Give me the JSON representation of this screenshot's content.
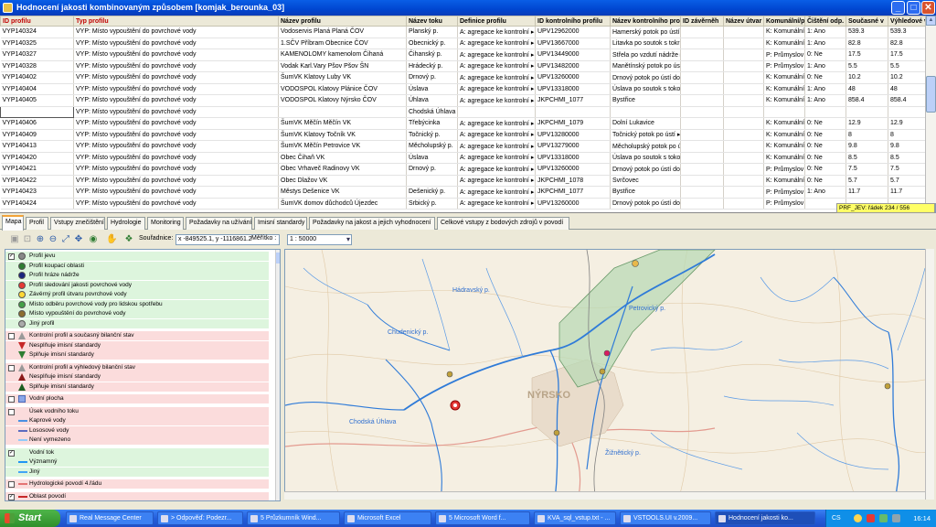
{
  "window": {
    "title": "Hodnocení  jakosti kombinovaným způsobem [komjak_berounka_03]"
  },
  "grid": {
    "columns": [
      "ID profilu",
      "Typ profilu",
      "Název profilu",
      "Název toku",
      "Definice profilu",
      "ID kontrolního profilu",
      "Název kontrolního profi",
      "ID závěrněh",
      "Název útvar",
      "Komunální/p",
      "Čištění odp.",
      "Současné v",
      "Výhledové v"
    ],
    "rows": [
      [
        "VYP140324",
        "VYP: Místo vypouštění do povrchové vody",
        "Vodoservis Planá Planá ČOV",
        "Planský p.",
        "A: agregace ke kontrolní ▸",
        "UPV12962000",
        "Hamerský potok po ústí ▸",
        "",
        "",
        "K: Komunální",
        "1: Ano",
        "539.3",
        "539.3"
      ],
      [
        "VYP140325",
        "VYP: Místo vypouštění do povrchové vody",
        "1.SČV Příbram Obecnice ČOV",
        "Obecnický p.",
        "A: agregace ke kontrolní ▸",
        "UPV13667000",
        "Litavka po soutok s tokr ▸",
        "",
        "",
        "K: Komunální",
        "1: Ano",
        "82.8",
        "82.8"
      ],
      [
        "VYP140327",
        "VYP: Místo vypouštění do povrchové vody",
        "KAMENOLOMY kamenolom Čihaná",
        "Čihanský p.",
        "A: agregace ke kontrolní ▸",
        "UPV13449000",
        "Střela po vzdutí nádrže ▸",
        "",
        "",
        "P: Průmyslov ▸",
        "0: Ne",
        "17.5",
        "17.5"
      ],
      [
        "VYP140328",
        "VYP: Místo vypouštění do povrchové vody",
        "Vodak Karl.Vary Pšov Pšov ŠN",
        "Hrádecký p.",
        "A: agregace ke kontrolní ▸",
        "UPV13482000",
        "Manětínský potok po ús ▸",
        "",
        "",
        "P: Průmyslov ▸",
        "1: Ano",
        "5.5",
        "5.5"
      ],
      [
        "VYP140402",
        "VYP: Místo vypouštění do povrchové vody",
        "ŠumVK Klatovy Luby VK",
        "Drnový p.",
        "A: agregace ke kontrolní ▸",
        "UPV13260000",
        "Drnový potok po ústí do ▸",
        "",
        "",
        "K: Komunální",
        "0: Ne",
        "10.2",
        "10.2"
      ],
      [
        "VYP140404",
        "VYP: Místo vypouštění do povrchové vody",
        "VODOSPOL Klatovy Plánice ČOV",
        "Úslava",
        "A: agregace ke kontrolní ▸",
        "UPV13318000",
        "Úslava po soutok s toko ▸",
        "",
        "",
        "K: Komunální",
        "1: Ano",
        "48",
        "48"
      ],
      [
        "VYP140405",
        "VYP: Místo vypouštění do povrchové vody",
        "VODOSPOL Klatovy Nýrsko ČOV",
        "Úhlava",
        "A: agregace ke kontrolní ▸",
        "JKPCHMI_1077",
        "Bystřice",
        "",
        "",
        "K: Komunální",
        "1: Ano",
        "858.4",
        "858.4"
      ],
      [
        "",
        "VYP: Místo vypouštění do povrchové vody",
        "",
        "Chodská Úhlava",
        "",
        "",
        "",
        "",
        "",
        "",
        "",
        "",
        ""
      ],
      [
        "VYP140406",
        "VYP: Místo vypouštění do povrchové vody",
        "ŠumVK Měčín Měčín VK",
        "Třebýcinka",
        "A: agregace ke kontrolní ▸",
        "JKPCHMI_1079",
        "Dolní Lukavice",
        "",
        "",
        "K: Komunální",
        "0: Ne",
        "12.9",
        "12.9"
      ],
      [
        "VYP140409",
        "VYP: Místo vypouštění do povrchové vody",
        "ŠumVK Klatovy Točník VK",
        "Točnický p.",
        "A: agregace ke kontrolní ▸",
        "UPV13280000",
        "Točnický potok po ústí ▸",
        "",
        "",
        "K: Komunální",
        "0: Ne",
        "8",
        "8"
      ],
      [
        "VYP140413",
        "VYP: Místo vypouštění do povrchové vody",
        "ŠumVK Měčín Petrovice VK",
        "Měcholupský p.",
        "A: agregace ke kontrolní ▸",
        "UPV13279000",
        "Měcholupský potok po ú ▸",
        "",
        "",
        "K: Komunální",
        "0: Ne",
        "9.8",
        "9.8"
      ],
      [
        "VYP140420",
        "VYP: Místo vypouštění do povrchové vody",
        "Obec Čihaň VK",
        "Úslava",
        "A: agregace ke kontrolní ▸",
        "UPV13318000",
        "Úslava po soutok s toko ▸",
        "",
        "",
        "K: Komunální",
        "0: Ne",
        "8.5",
        "8.5"
      ],
      [
        "VYP140421",
        "VYP: Místo vypouštění do povrchové vody",
        "Obec Vrhaveč Radinovy VK",
        "Drnový p.",
        "A: agregace ke kontrolní ▸",
        "UPV13260000",
        "Drnový potok po ústí do ▸",
        "",
        "",
        "P: Průmyslov ▸",
        "0: Ne",
        "7.5",
        "7.5"
      ],
      [
        "VYP140422",
        "VYP: Místo vypouštění do povrchové vody",
        "Obec Dlažov VK",
        "",
        "A: agregace ke kontrolní ▸",
        "JKPCHMI_1078",
        "Svrčovec",
        "",
        "",
        "K: Komunální",
        "0: Ne",
        "5.7",
        "5.7"
      ],
      [
        "VYP140423",
        "VYP: Místo vypouštění do povrchové vody",
        "Městys Dešenice VK",
        "Dešenický p.",
        "A: agregace ke kontrolní ▸",
        "JKPCHMI_1077",
        "Bystřice",
        "",
        "",
        "P: Průmyslov ▸",
        "1: Ano",
        "11.7",
        "11.7"
      ],
      [
        "VYP140424",
        "VYP: Místo vypouštění do povrchové vody",
        "ŠumVK domov důchodců Újezdec",
        "Srbický p.",
        "A: agregace ke kontrolní ▸",
        "UPV13260000",
        "Drnový potok po ústí do ▸",
        "",
        "",
        "P: Průmyslov ▸",
        "",
        "",
        ""
      ]
    ],
    "status": "PRF_JEV: řádek 234 / 556"
  },
  "tabs": [
    "Mapa",
    "Profil",
    "Vstupy znečištění",
    "Hydrologie",
    "Monitoring",
    "Požadavky na užívání",
    "Imisní standardy",
    "Požadavky na jakost a jejich vyhodnocení",
    "Celkové vstupy z bodových zdrojů v povodí"
  ],
  "toolbar": {
    "coord_label": "Souřadnice:",
    "coord_value": "x -849525.1, y -1116861.2",
    "scale_label": "Měřítko :",
    "scale_value": "1 : 50000"
  },
  "legend": [
    {
      "text": "Profil jevu",
      "check": true,
      "kind": "dot",
      "color": "#888"
    },
    {
      "text": "Profil koupací oblasti",
      "kind": "dot",
      "color": "#2e7d32"
    },
    {
      "text": "Profil hráze nádrže",
      "kind": "dot",
      "color": "#1a237e"
    },
    {
      "text": "Profil sledování jakosti povrchové vody",
      "kind": "dot",
      "color": "#e53935"
    },
    {
      "text": "Závěrný profil útvaru povrchové vody",
      "kind": "dot",
      "color": "#fdd835"
    },
    {
      "text": "Místo odběru povrchové vody pro lidskou spotřebu",
      "kind": "dot",
      "color": "#43a047"
    },
    {
      "text": "Místo vypouštění do povrchové vody",
      "kind": "dot",
      "color": "#8d6e2f"
    },
    {
      "text": "Jiný profil",
      "kind": "dot",
      "color": "#aaa"
    },
    {
      "text": "Kontrolní profil a současný bilanční stav",
      "check": false,
      "kind": "tri-up",
      "color": "#999"
    },
    {
      "text": "Nesplňuje imisní standardy",
      "kind": "tri-down",
      "color": "#c62828"
    },
    {
      "text": "Splňuje imisní standardy",
      "kind": "tri-down",
      "color": "#2e7d32"
    },
    {
      "text": "Kontrolní profil a výhledový bilanční stav",
      "check": false,
      "kind": "tri-up",
      "color": "#999"
    },
    {
      "text": "Nesplňuje imisní standardy",
      "kind": "tri-up",
      "color": "#8b1a1a"
    },
    {
      "text": "Splňuje imisní standardy",
      "kind": "tri-up",
      "color": "#1b5e20"
    },
    {
      "text": "Vodní plocha",
      "check": false,
      "kind": "square",
      "color": "#8aa6e8"
    },
    {
      "text": "Úsek vodního toku",
      "check": false,
      "kind": "none",
      "color": "#000"
    },
    {
      "text": "Kaprové vody",
      "kind": "line",
      "color": "#4a90e2"
    },
    {
      "text": "Lososové vody",
      "kind": "line",
      "color": "#5c6bc0"
    },
    {
      "text": "Není vymezeno",
      "kind": "line",
      "color": "#90caf9"
    },
    {
      "text": "Vodní tok",
      "check": true,
      "kind": "none",
      "color": "#000"
    },
    {
      "text": "Významný",
      "kind": "line",
      "color": "#2196f3"
    },
    {
      "text": "Jiný",
      "kind": "line",
      "color": "#42a5f5"
    },
    {
      "text": "Hydrologické povodí 4.řádu",
      "check": false,
      "kind": "line",
      "color": "#e57373"
    },
    {
      "text": "Oblast povodí",
      "check": true,
      "kind": "line",
      "color": "#c62828"
    }
  ],
  "map": {
    "labels": [
      "Hádravský p.",
      "Chudenický p.",
      "Petrovický p.",
      "Chodská Úhlava",
      "Žižnětický p.",
      "NÝRSKO"
    ]
  },
  "taskbar": {
    "start": "Start",
    "items": [
      "Real Message Center",
      "> Odpověď: Podezr...",
      "5 Průzkumník Wind...",
      "Microsoft Excel",
      "5 Microsoft Word f...",
      "KVA_sql_vstup.txt - ...",
      "VSTOOLS.UI v.2009...",
      "Hodnocení  jakosti ko..."
    ],
    "lang": "CS",
    "clock": "16:14"
  }
}
